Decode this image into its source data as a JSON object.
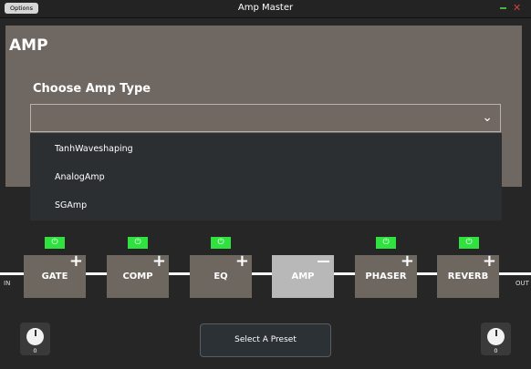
{
  "window": {
    "title": "Amp Master",
    "options_label": "Options",
    "minimize_icon": "minimize-icon",
    "close_icon": "close-icon"
  },
  "amp_panel": {
    "title": "AMP",
    "choose_label": "Choose Amp Type",
    "selected_value": "",
    "dropdown_icon": "chevron-down-icon",
    "options": [
      "TanhWaveshaping",
      "AnalogAmp",
      "SGAmp"
    ]
  },
  "chain": {
    "in_label": "IN",
    "out_label": "OUT",
    "effects": [
      {
        "label": "GATE",
        "power": "⏻",
        "power_color": "#2fe23f",
        "icon": "plus-icon"
      },
      {
        "label": "COMP",
        "power": "⏻",
        "power_color": "#2fe23f",
        "icon": "plus-icon"
      },
      {
        "label": "EQ",
        "power": "⏻",
        "power_color": "#2fe23f",
        "icon": "plus-icon"
      },
      {
        "label": "AMP",
        "icon": "minus-icon",
        "active": true
      },
      {
        "label": "PHASER",
        "power": "⏻",
        "power_color": "#2fe23f",
        "icon": "plus-icon"
      },
      {
        "label": "REVERB",
        "power": "⏻",
        "power_color": "#2fe23f",
        "icon": "plus-icon"
      }
    ]
  },
  "footer": {
    "preset_label": "Select A Preset",
    "input_knob_value": "0",
    "output_knob_value": "0"
  }
}
